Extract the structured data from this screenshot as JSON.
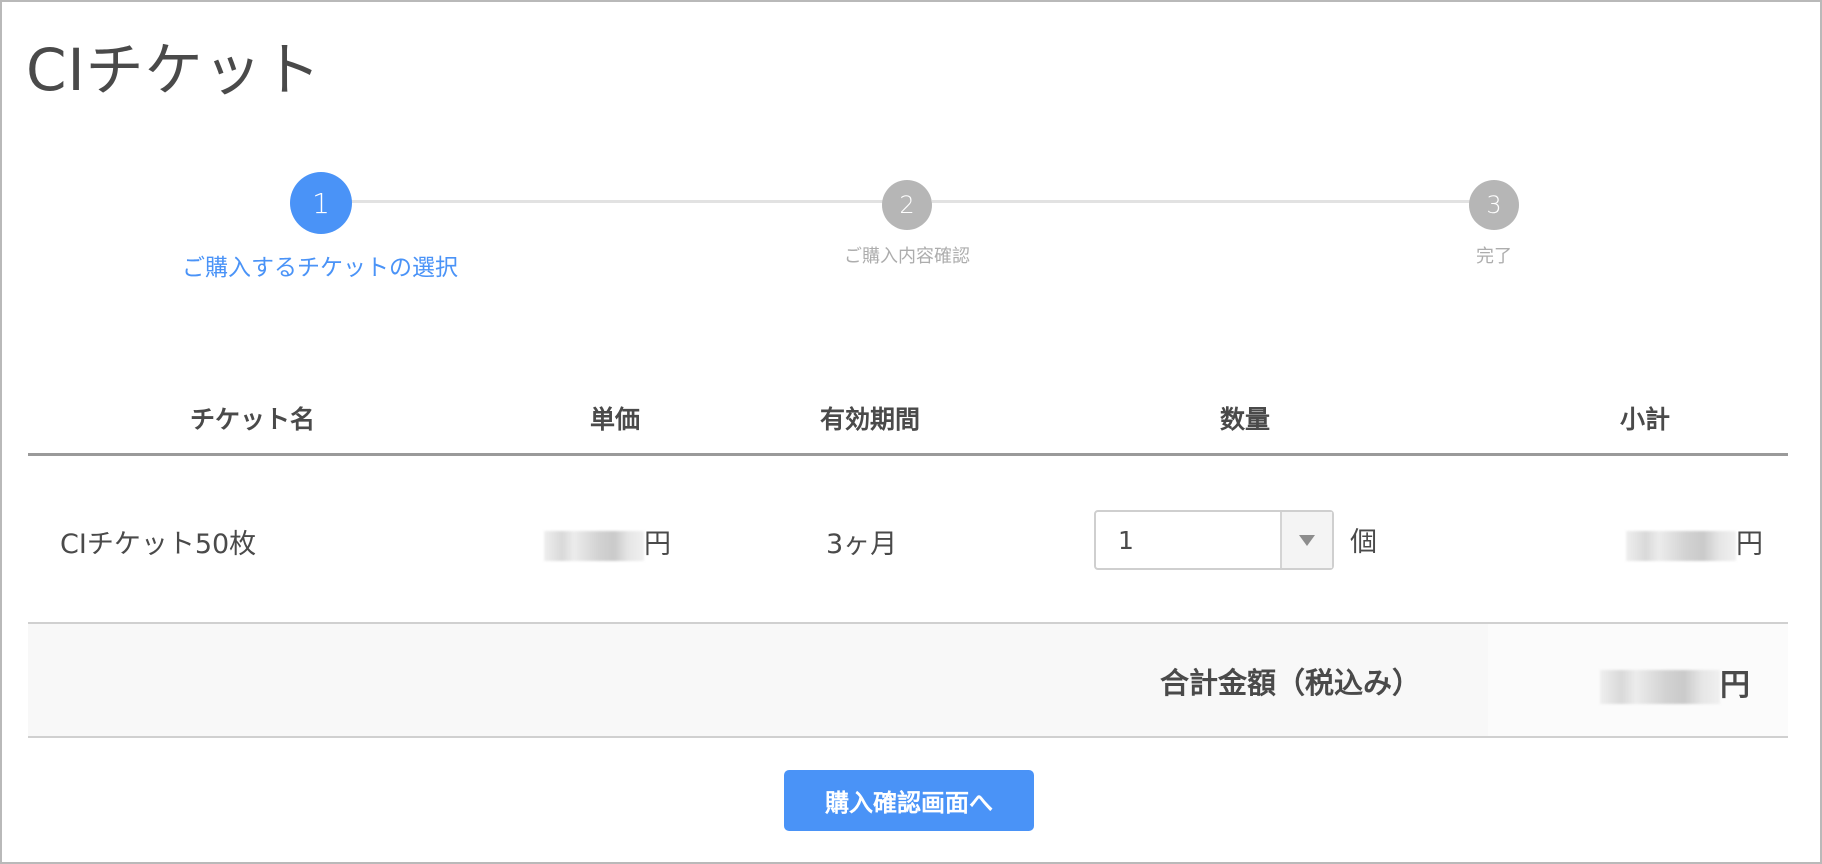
{
  "page": {
    "title": "CIチケット"
  },
  "stepper": {
    "steps": [
      {
        "number": "1",
        "label": "ご購入するチケットの選択",
        "active": true
      },
      {
        "number": "2",
        "label": "ご購入内容確認",
        "active": false
      },
      {
        "number": "3",
        "label": "完了",
        "active": false
      }
    ]
  },
  "table": {
    "headers": {
      "name": "チケット名",
      "unit_price": "単価",
      "validity": "有効期間",
      "quantity": "数量",
      "subtotal": "小計"
    },
    "rows": [
      {
        "name": "CIチケット50枚",
        "unit_price_suffix": "円",
        "validity": "3ヶ月",
        "quantity_value": "1",
        "quantity_unit": "個",
        "subtotal_suffix": "円"
      }
    ],
    "total": {
      "label": "合計金額（税込み）",
      "value_suffix": "円"
    }
  },
  "actions": {
    "confirm_label": "購入確認画面へ"
  },
  "colors": {
    "accent": "#4a93f7",
    "inactive_step": "#b6b6b6"
  }
}
